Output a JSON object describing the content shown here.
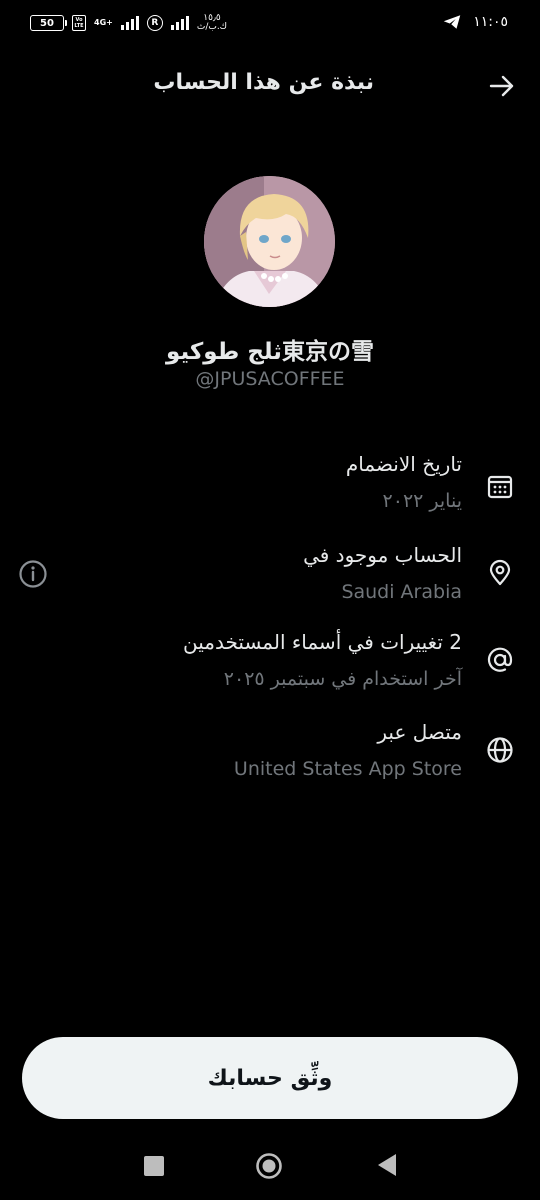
{
  "status_bar": {
    "battery": "50",
    "network": "4G+",
    "speed": "١٥٫٥",
    "speed_unit": "ك.ب/ث",
    "time": "١١:٠٥"
  },
  "header": {
    "title": "نبذة عن هذا الحساب"
  },
  "profile": {
    "display_name": "ثلج طوكيو東京の雪",
    "handle": "@JPUSACOFFEE"
  },
  "info": [
    {
      "title": "تاريخ الانضمام",
      "subtitle": "يناير ٢٠٢٢",
      "icon": "calendar-icon"
    },
    {
      "title": "الحساب موجود في",
      "subtitle": "Saudi Arabia",
      "icon": "location-pin-icon"
    },
    {
      "title": "2 تغييرات في أسماء المستخدمين",
      "subtitle": "آخر استخدام في سبتمبر ٢٠٢٥",
      "icon": "at-sign-icon"
    },
    {
      "title": "متصل عبر",
      "subtitle": "United States App Store",
      "icon": "globe-icon"
    }
  ],
  "verify_button": {
    "label": "وثِّق حسابك"
  },
  "colors": {
    "background": "#000000",
    "primary_text": "#e7e9ea",
    "secondary_text": "#71767b",
    "button_bg": "#eff3f4"
  }
}
